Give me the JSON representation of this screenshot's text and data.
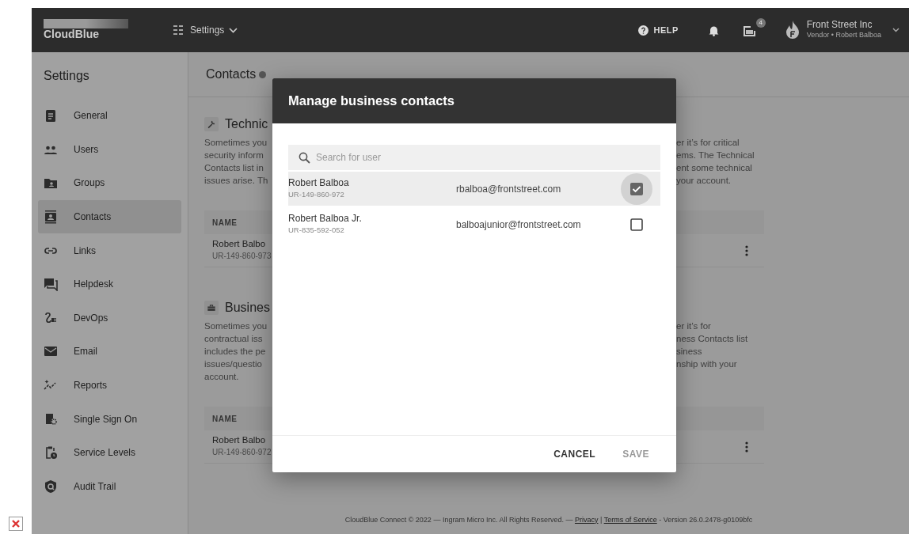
{
  "header": {
    "logo": "CloudBlue",
    "menu": "Settings",
    "help": "HELP",
    "inbox_badge": "4",
    "account": {
      "name": "Front Street Inc",
      "subtitle": "Vendor • Robert Balboa"
    }
  },
  "sidebar": {
    "title": "Settings",
    "items": [
      {
        "label": "General",
        "selected": false
      },
      {
        "label": "Users",
        "selected": false
      },
      {
        "label": "Groups",
        "selected": false
      },
      {
        "label": "Contacts",
        "selected": true
      },
      {
        "label": "Links",
        "selected": false
      },
      {
        "label": "Helpdesk",
        "selected": false
      },
      {
        "label": "DevOps",
        "selected": false
      },
      {
        "label": "Email",
        "selected": false
      },
      {
        "label": "Reports",
        "selected": false
      },
      {
        "label": "Single Sign On",
        "selected": false
      },
      {
        "label": "Service Levels",
        "selected": false
      },
      {
        "label": "Audit Trail",
        "selected": false
      }
    ]
  },
  "page": {
    "title": "Contacts",
    "sections": [
      {
        "title": "Technic",
        "text_left": [
          "Sometimes you",
          "security inform",
          "Contacts list in",
          "issues arise. Th"
        ],
        "text_right": [
          "er it’s for critical",
          "ems. The Technical",
          "ent some technical",
          "your account."
        ],
        "column_1": "NAME",
        "rows": [
          {
            "name": "Robert Balbo",
            "id": "UR-149-860-973"
          }
        ]
      },
      {
        "title": "Busines",
        "text_left": [
          "Sometimes you",
          "contractual iss",
          "includes the pe",
          "issues/questio",
          "account."
        ],
        "text_right": [
          "er it’s for",
          "ness Contacts list",
          "siness",
          "nship with your"
        ],
        "column_1": "NAME",
        "rows": [
          {
            "name": "Robert Balbo",
            "id": "UR-149-860-972"
          }
        ]
      }
    ],
    "footer": {
      "text": "CloudBlue Connect © 2022 — Ingram Micro Inc. All Rights Reserved. —",
      "links": [
        "Privacy",
        "Terms of Service"
      ],
      "separator": "|",
      "version": "- Version 26.0.2478-g0109bfc"
    }
  },
  "dialog": {
    "title": "Manage business contacts",
    "search": {
      "placeholder": "Search for user"
    },
    "users": [
      {
        "name": "Robert Balboa",
        "id": "UR-149-860-972",
        "email": "rbalboa@frontstreet.com",
        "checked": true,
        "hovered": true
      },
      {
        "name": "Robert Balboa Jr.",
        "id": "UR-835-592-052",
        "email": "balboajunior@frontstreet.com",
        "checked": false,
        "hovered": false
      }
    ],
    "buttons": [
      {
        "label": "CANCEL",
        "disabled": false
      },
      {
        "label": "SAVE",
        "disabled": true
      }
    ]
  }
}
